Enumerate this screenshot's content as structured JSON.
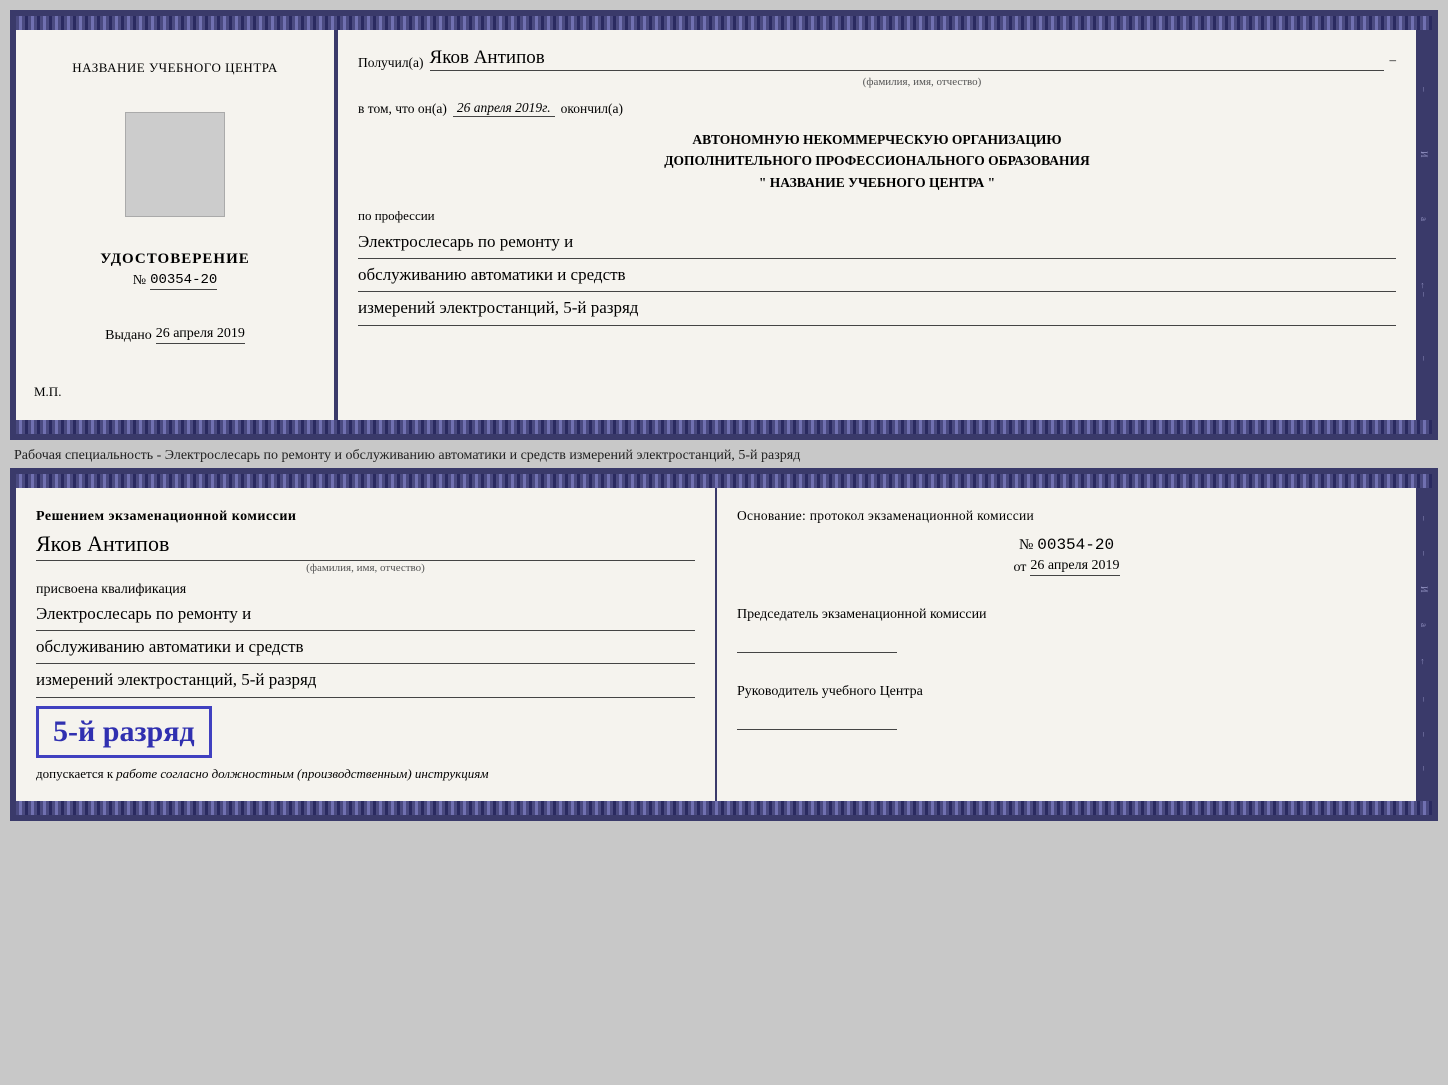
{
  "page": {
    "background": "#c8c8c8"
  },
  "top_doc": {
    "left": {
      "org_name": "НАЗВАНИЕ УЧЕБНОГО ЦЕНТРА",
      "cert_title": "УДОСТОВЕРЕНИЕ",
      "cert_number_prefix": "№",
      "cert_number": "00354-20",
      "vydano_label": "Выдано",
      "vydano_date": "26 апреля 2019",
      "mp_label": "М.П."
    },
    "right": {
      "poluchil_label": "Получил(а)",
      "recipient_name": "Яков Антипов",
      "fio_sub": "(фамилия, имя, отчество)",
      "vtom_label": "в том, что он(а)",
      "date_value": "26 апреля 2019г.",
      "okonchil_label": "окончил(а)",
      "org_line1": "АВТОНОМНУЮ НЕКОММЕРЧЕСКУЮ ОРГАНИЗАЦИЮ",
      "org_line2": "ДОПОЛНИТЕЛЬНОГО ПРОФЕССИОНАЛЬНОГО ОБРАЗОВАНИЯ",
      "org_line3": "\" НАЗВАНИЕ УЧЕБНОГО ЦЕНТРА \"",
      "po_professii": "по профессии",
      "profession_line1": "Электрослесарь по ремонту и",
      "profession_line2": "обслуживанию автоматики и средств",
      "profession_line3": "измерений электростанций, 5-й разряд"
    }
  },
  "separator": {
    "text": "Рабочая специальность - Электрослесарь по ремонту и обслуживанию автоматики и средств измерений электростанций, 5-й разряд"
  },
  "bottom_doc": {
    "left": {
      "resheniem_title": "Решением экзаменационной комиссии",
      "person_name": "Яков Антипов",
      "fio_sub": "(фамилия, имя, отчество)",
      "prisvoena_label": "присвоена квалификация",
      "qual_line1": "Электрослесарь по ремонту и",
      "qual_line2": "обслуживанию автоматики и средств",
      "qual_line3": "измерений электростанций, 5-й разряд",
      "rank_badge": "5-й разряд",
      "dopuskaetsya_label": "допускается к",
      "dopuskaetsya_text": "работе согласно должностным (производственным) инструкциям"
    },
    "right": {
      "osnovanie_label": "Основание: протокол экзаменационной комиссии",
      "number_prefix": "№",
      "protocol_number": "00354-20",
      "ot_label": "от",
      "ot_date": "26 апреля 2019",
      "predsedatel_title": "Председатель экзаменационной комиссии",
      "rukovoditel_title": "Руководитель учебного Центра"
    }
  }
}
